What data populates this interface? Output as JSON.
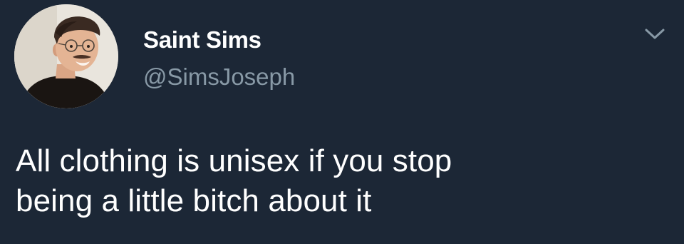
{
  "tweet": {
    "author": {
      "display_name": "Saint Sims",
      "handle": "@SimsJoseph",
      "avatar": "profile-photo"
    },
    "menu_icon": "chevron-down-icon",
    "text_lines": [
      "All clothing is unisex if you stop",
      "being a little bitch about it"
    ]
  },
  "colors": {
    "background": "#1c2736",
    "primary_text": "#ffffff",
    "secondary_text": "#8899a6"
  }
}
